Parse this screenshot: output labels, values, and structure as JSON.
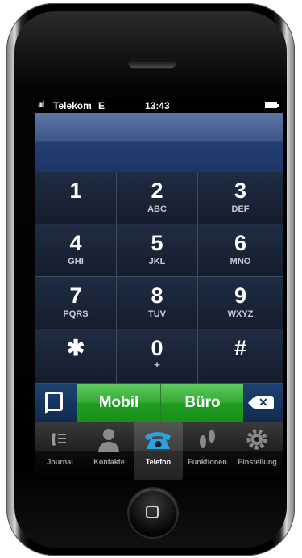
{
  "status_bar": {
    "signal": ".ııl",
    "carrier": "Telekom",
    "network": "E",
    "time": "13:43"
  },
  "keypad": {
    "keys": [
      {
        "digit": "1",
        "letters": ""
      },
      {
        "digit": "2",
        "letters": "ABC"
      },
      {
        "digit": "3",
        "letters": "DEF"
      },
      {
        "digit": "4",
        "letters": "GHI"
      },
      {
        "digit": "5",
        "letters": "JKL"
      },
      {
        "digit": "6",
        "letters": "MNO"
      },
      {
        "digit": "7",
        "letters": "PQRS"
      },
      {
        "digit": "8",
        "letters": "TUV"
      },
      {
        "digit": "9",
        "letters": "WXYZ"
      },
      {
        "digit": "✱",
        "letters": ""
      },
      {
        "digit": "0",
        "letters": "+"
      },
      {
        "digit": "#",
        "letters": ""
      }
    ]
  },
  "actions": {
    "call_mobile": "Mobil",
    "call_office": "Büro"
  },
  "tabs": [
    {
      "label": "Journal",
      "icon": "journal-icon"
    },
    {
      "label": "Kontakte",
      "icon": "contacts-icon"
    },
    {
      "label": "Telefon",
      "icon": "phone-icon",
      "active": true
    },
    {
      "label": "Funktionen",
      "icon": "features-icon"
    },
    {
      "label": "Einstellung",
      "icon": "settings-icon"
    }
  ],
  "colors": {
    "call_green": "#2ea82e",
    "display_blue": "#223f74",
    "active_tab_icon": "#29a3e0"
  }
}
